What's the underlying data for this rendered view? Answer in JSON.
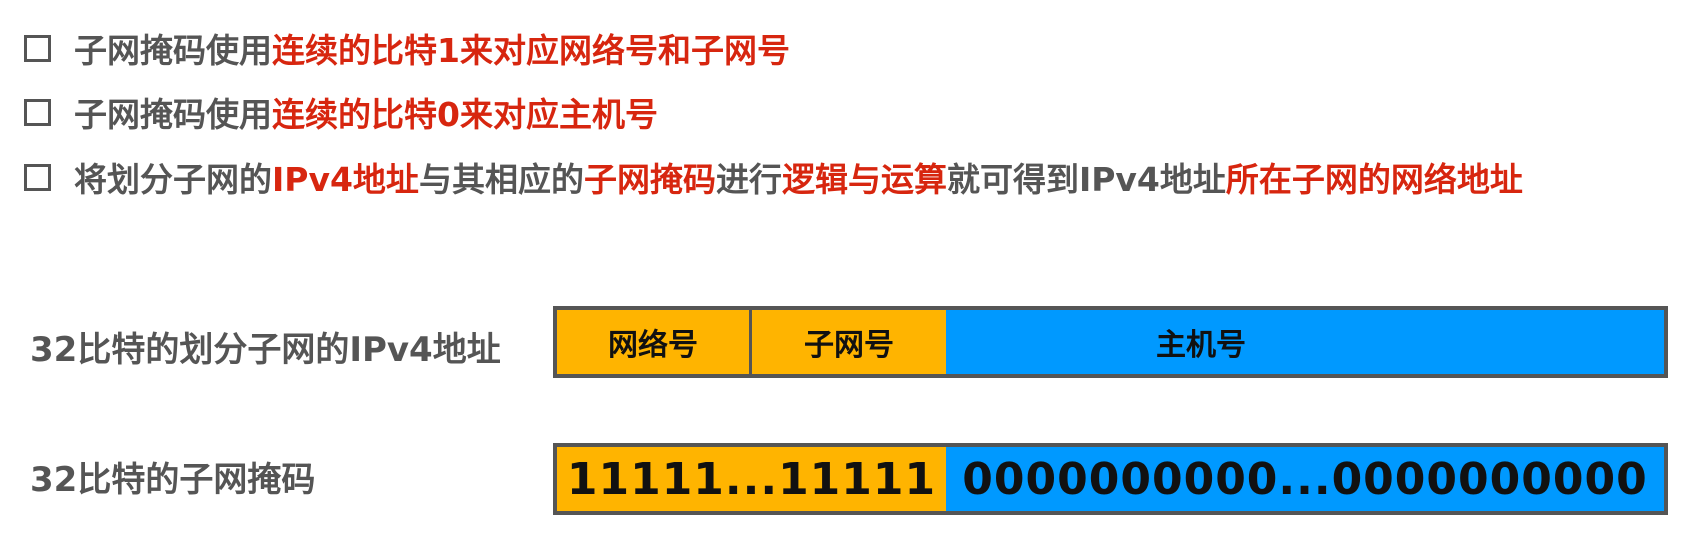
{
  "colors": {
    "red": "#d7260f",
    "orange": "#ffb400",
    "blue": "#0099ff",
    "gray_text": "#555555"
  },
  "bullets": [
    [
      {
        "t": "子网掩码使用",
        "hl": false
      },
      {
        "t": "连续的比特1来对应网络号和子网号",
        "hl": true
      }
    ],
    [
      {
        "t": "子网掩码使用",
        "hl": false
      },
      {
        "t": "连续的比特0来对应主机号",
        "hl": true
      }
    ],
    [
      {
        "t": "将划分子网的",
        "hl": false
      },
      {
        "t": "IPv4地址",
        "hl": true
      },
      {
        "t": "与其相应的",
        "hl": false
      },
      {
        "t": "子网掩码",
        "hl": true
      },
      {
        "t": "进行",
        "hl": false
      },
      {
        "t": "逻辑与运算",
        "hl": true
      },
      {
        "t": "就可得到IPv4地址",
        "hl": false
      },
      {
        "t": "所在子网的网络地址",
        "hl": true
      }
    ]
  ],
  "address_row": {
    "label": "32比特的划分子网的IPv4地址",
    "segments": {
      "network": "网络号",
      "subnet": "子网号",
      "host": "主机号"
    }
  },
  "mask_row": {
    "label": "32比特的子网掩码",
    "ones": "11111...11111",
    "zeros": "0000000000...0000000000"
  }
}
